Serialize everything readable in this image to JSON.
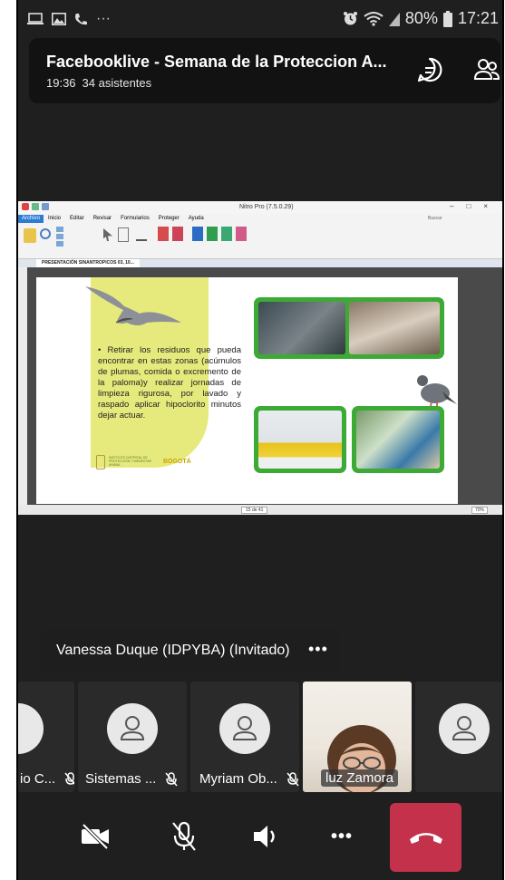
{
  "status_bar": {
    "dots": "···",
    "battery": "80%",
    "time": "17:21",
    "icons": [
      "screen-cast-icon",
      "image-icon",
      "phone-icon",
      "alarm-icon",
      "wifi-icon",
      "signal-icon",
      "battery-icon"
    ]
  },
  "meeting": {
    "title": "Facebooklive - Semana de la Proteccion A...",
    "duration": "19:36",
    "attendees": "34 asistentes"
  },
  "shared_screen": {
    "app_title": "Nitro Pro (7.5.0.29)",
    "menu_tabs": [
      "Archivo",
      "Inicio",
      "Editar",
      "Revisar",
      "Formularios",
      "Proteger",
      "Ayuda"
    ],
    "doc_tab": "PRESENTACIÓN SINANTROPICOS 03, 10...",
    "search_placeholder": "Buscar",
    "page_indicator": "15 de 41",
    "zoom": "70%",
    "slide": {
      "bullet_text": "• Retirar los residuos que pueda encontrar en estas zonas (acúmulos de plumas, comida o excremento de la paloma)y realizar jornadas de limpieza rigurosa, por lavado y raspado aplicar hipoclorito minutos dejar actuar.",
      "footer_org": "INSTITUTO DISTRITAL DE PROTECCIÓN Y BIENESTAR ANIMAL",
      "footer_city": "BOGOTÁ",
      "colors": {
        "yellow": "#e6ea7c",
        "green": "#3daa35"
      }
    }
  },
  "speaker": {
    "name": "Vanessa Duque (IDPYBA) (Invitado)",
    "more": "•••"
  },
  "participants": [
    {
      "name": "io C...",
      "muted": true
    },
    {
      "name": "Sistemas ...",
      "muted": true
    },
    {
      "name": "Myriam Ob...",
      "muted": true
    },
    {
      "name": "luz Zamora",
      "muted": false
    },
    {
      "name": "",
      "muted": false
    }
  ],
  "controls": {
    "more": "•••",
    "colors": {
      "hangup": "#c4314b"
    }
  }
}
